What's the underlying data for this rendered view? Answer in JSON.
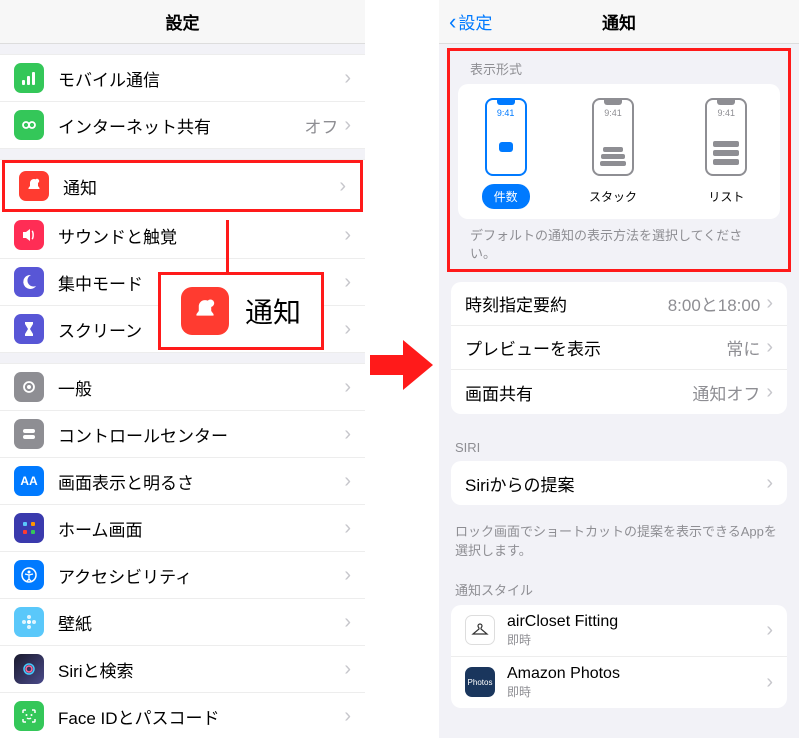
{
  "left": {
    "title": "設定",
    "g1": [
      {
        "label": "モバイル通信",
        "value": ""
      },
      {
        "label": "インターネット共有",
        "value": "オフ"
      }
    ],
    "g2": [
      {
        "label": "通知",
        "value": "",
        "hl": true
      },
      {
        "label": "サウンドと触覚",
        "value": ""
      },
      {
        "label": "集中モード",
        "value": ""
      },
      {
        "label": "スクリーン",
        "value": ""
      }
    ],
    "g3": [
      {
        "label": "一般"
      },
      {
        "label": "コントロールセンター"
      },
      {
        "label": "画面表示と明るさ"
      },
      {
        "label": "ホーム画面"
      },
      {
        "label": "アクセシビリティ"
      },
      {
        "label": "壁紙"
      },
      {
        "label": "Siriと検索"
      },
      {
        "label": "Face IDとパスコード"
      }
    ],
    "callout": "通知"
  },
  "right": {
    "back": "設定",
    "title": "通知",
    "sect_display": "表示形式",
    "time": "9:41",
    "opt_count": "件数",
    "opt_stack": "スタック",
    "opt_list": "リスト",
    "display_foot": "デフォルトの通知の表示方法を選択してください。",
    "timed": {
      "label": "時刻指定要約",
      "value": "8:00と18:00"
    },
    "preview": {
      "label": "プレビューを表示",
      "value": "常に"
    },
    "share": {
      "label": "画面共有",
      "value": "通知オフ"
    },
    "siri_head": "SIRI",
    "siri_row": "Siriからの提案",
    "siri_foot": "ロック画面でショートカットの提案を表示できるAppを選択します。",
    "style_head": "通知スタイル",
    "apps": [
      {
        "name": "airCloset Fitting",
        "sub": "即時"
      },
      {
        "name": "Amazon Photos",
        "sub": "即時"
      }
    ]
  }
}
